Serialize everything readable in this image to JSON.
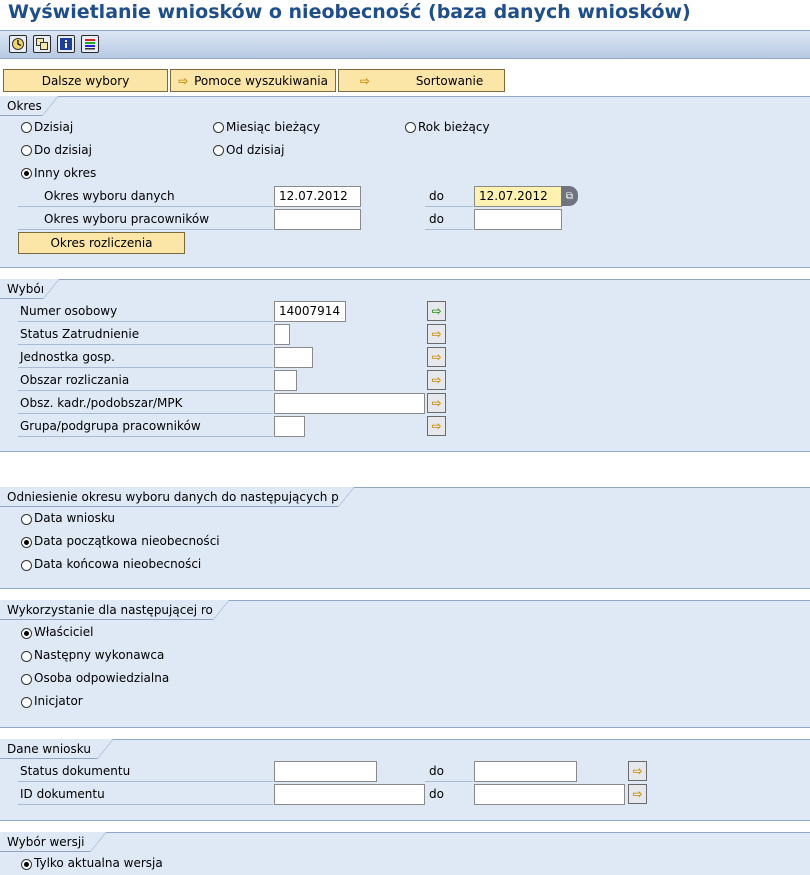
{
  "title": "Wyświetlanie wniosków o nieobecność (baza danych wniosków)",
  "toolbar_icons": [
    "execute-icon",
    "copy-icon",
    "info-icon",
    "layout-icon"
  ],
  "selection_buttons": {
    "further": "Dalsze wybory",
    "search_help": "Pomoce wyszukiwania",
    "sort": "Sortowanie"
  },
  "okres": {
    "title": "Okres",
    "radios": {
      "today": "Dzisiaj",
      "current_month": "Miesiąc bieżący",
      "current_year": "Rok bieżący",
      "up_to_today": "Do dzisiaj",
      "from_today": "Od dzisiaj",
      "other_period": "Inny okres"
    },
    "selected": "other_period",
    "data_period_label": "Okres wyboru danych",
    "data_from": "12.07.2012",
    "to_label": "do",
    "data_to": "12.07.2012",
    "employee_period_label": "Okres wyboru pracowników",
    "employee_from": "",
    "employee_to": "",
    "settlement_button": "Okres rozliczenia"
  },
  "wybor": {
    "title": "Wybór",
    "rows": [
      {
        "label": "Numer osobowy",
        "value": "14007914"
      },
      {
        "label": "Status Zatrudnienie",
        "value": ""
      },
      {
        "label": "Jednostka gosp.",
        "value": ""
      },
      {
        "label": "Obszar rozliczania",
        "value": ""
      },
      {
        "label": "Obsz. kadr./podobszar/MPK",
        "value": ""
      },
      {
        "label": "Grupa/podgrupa pracowników",
        "value": ""
      }
    ]
  },
  "odniesienie": {
    "title": "Odniesienie okresu wyboru danych do następujących pól",
    "options": [
      "Data wniosku",
      "Data początkowa nieobecności",
      "Data końcowa nieobecności"
    ],
    "selected_index": 1
  },
  "rola": {
    "title": "Wykorzystanie dla następującej roli",
    "options": [
      "Właściciel",
      "Następny wykonawca",
      "Osoba odpowiedzialna",
      "Inicjator"
    ],
    "selected_index": 0
  },
  "dane": {
    "title": "Dane wniosku",
    "rows": [
      {
        "label": "Status dokumentu",
        "from": "",
        "to": ""
      },
      {
        "label": "ID dokumentu",
        "from": "",
        "to": ""
      }
    ],
    "to_label": "do"
  },
  "wersja": {
    "title": "Wybór wersji",
    "options": [
      "Tylko aktualna wersja"
    ],
    "selected_index": 0
  }
}
